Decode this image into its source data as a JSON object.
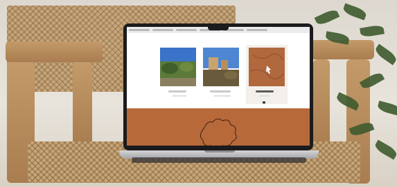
{
  "scene": {
    "description_free": true
  },
  "screen": {
    "tab_count": 6,
    "gallery": {
      "items": [
        {
          "name": "photo-landscape",
          "caption": "",
          "sub": ""
        },
        {
          "name": "photo-ruins",
          "caption": "",
          "sub": ""
        },
        {
          "name": "photo-map",
          "caption": "",
          "sub": ""
        }
      ]
    }
  },
  "colors": {
    "footer": "#b8693a",
    "wood": "#b98b5a",
    "cane": "#c7a67a"
  }
}
